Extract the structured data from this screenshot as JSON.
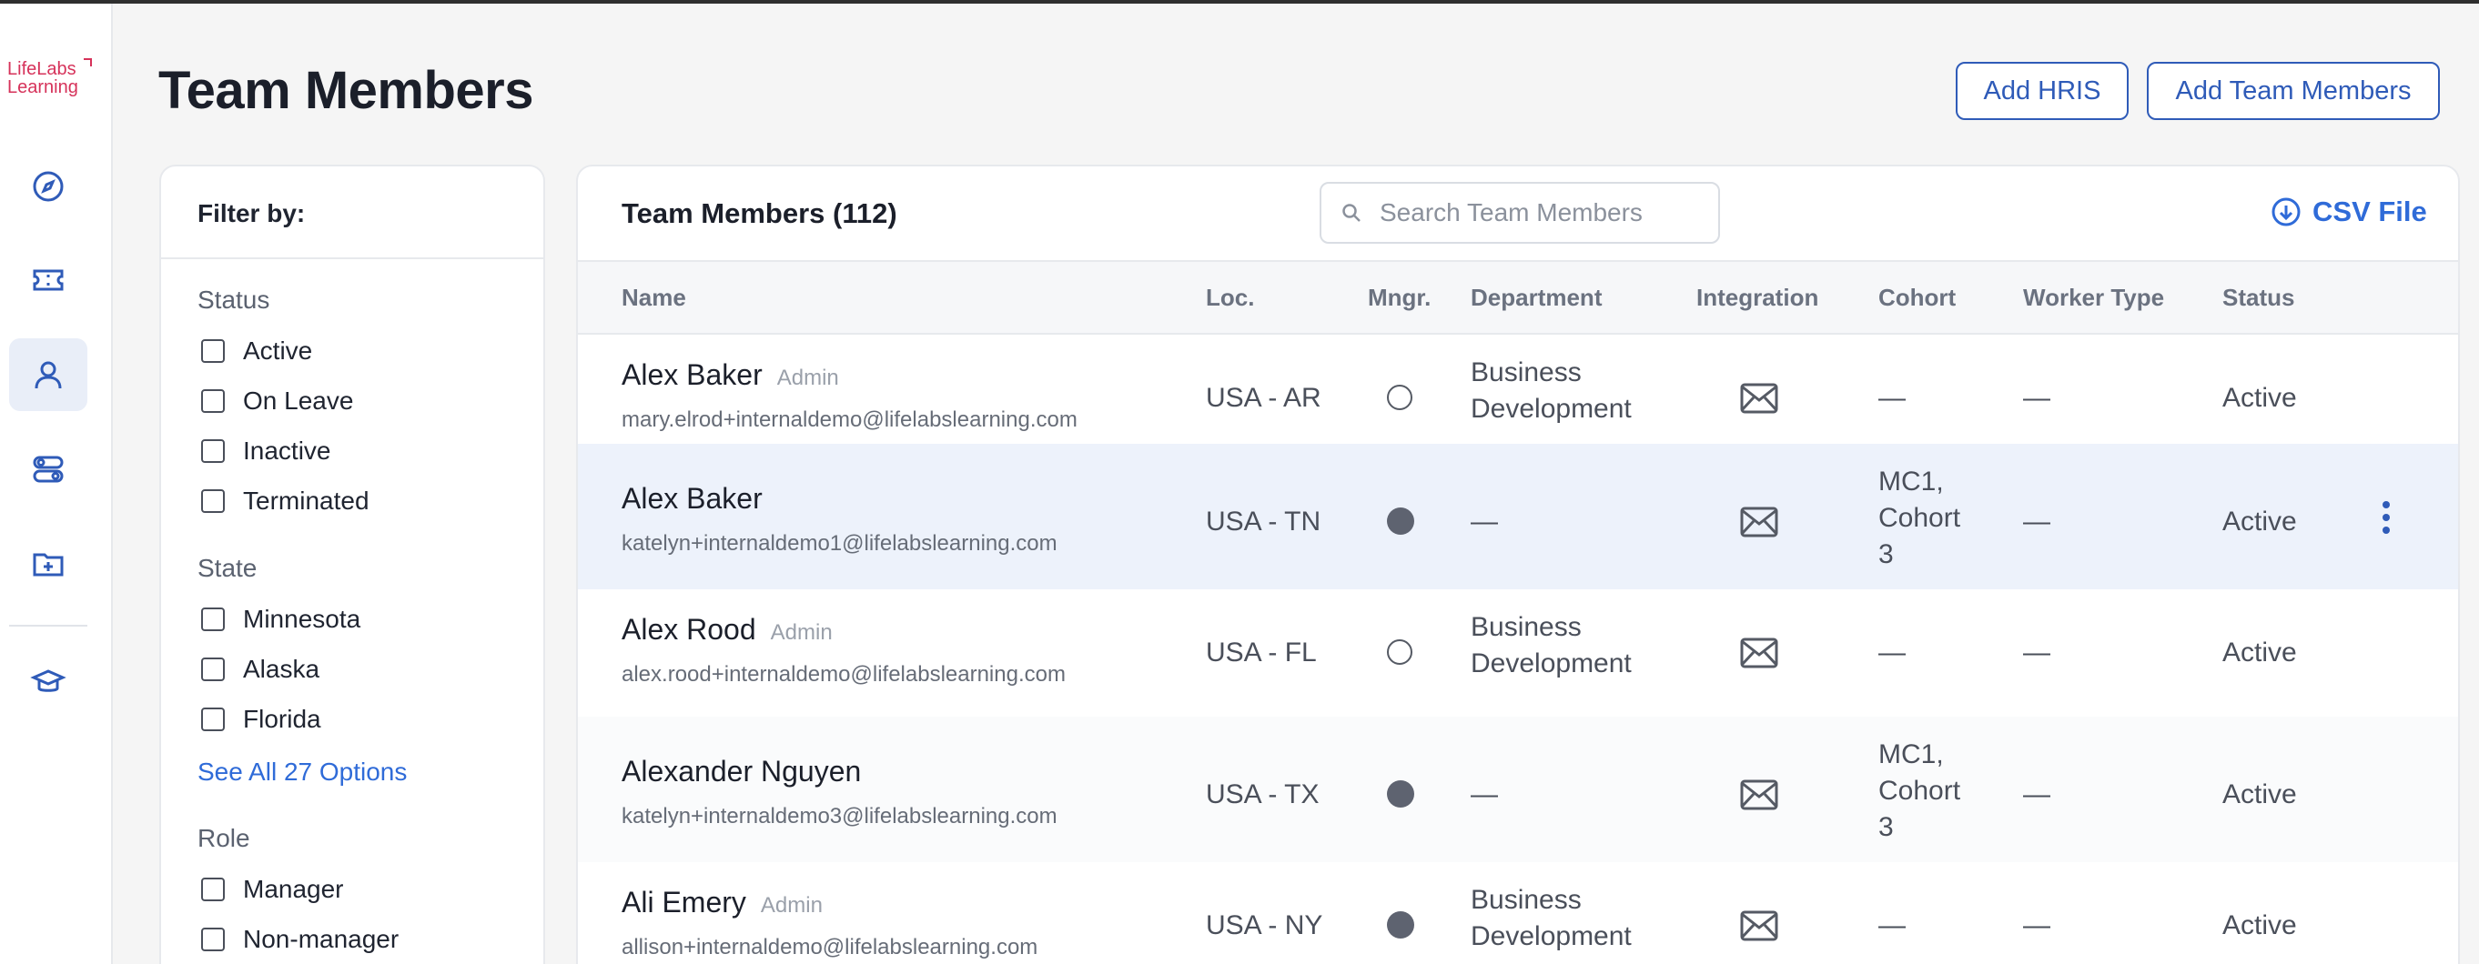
{
  "app": {
    "logo_line1": "LifeLabs",
    "logo_line2": "Learning",
    "brand_color": "#d6325a",
    "accent_color": "#2f5bb8"
  },
  "nav": {
    "items": [
      {
        "icon": "compass-icon"
      },
      {
        "icon": "ticket-icon"
      },
      {
        "icon": "user-icon",
        "active": true
      },
      {
        "icon": "toggles-icon"
      },
      {
        "icon": "folder-plus-icon"
      },
      {
        "icon": "graduation-cap-icon"
      }
    ]
  },
  "header": {
    "title": "Team Members",
    "add_hris_label": "Add HRIS",
    "add_team_members_label": "Add Team Members"
  },
  "filter": {
    "title": "Filter by:",
    "status_label": "Status",
    "status_options": [
      "Active",
      "On Leave",
      "Inactive",
      "Terminated"
    ],
    "state_label": "State",
    "state_options": [
      "Minnesota",
      "Alaska",
      "Florida"
    ],
    "state_more_link": "See All 27 Options",
    "role_label": "Role",
    "role_options": [
      "Manager",
      "Non-manager"
    ]
  },
  "table": {
    "title": "Team Members (112)",
    "search_placeholder": "Search Team Members",
    "csv_label": "CSV File",
    "columns": [
      "Name",
      "Loc.",
      "Mngr.",
      "Department",
      "Integration",
      "Cohort",
      "Worker Type",
      "Status"
    ],
    "rows": [
      {
        "name": "Alex Baker",
        "admin": "Admin",
        "email": "mary.elrod+internaldemo@lifelabslearning.com",
        "loc": "USA - AR",
        "manager": false,
        "dept1": "Business",
        "dept2": "Development",
        "cohort1": "—",
        "cohort2": "",
        "cohort3": "",
        "worker_type": "—",
        "status": "Active"
      },
      {
        "name": "Alex Baker",
        "admin": "",
        "email": "katelyn+internaldemo1@lifelabslearning.com",
        "loc": "USA - TN",
        "manager": true,
        "dept1": "—",
        "dept2": "",
        "cohort1": "MC1,",
        "cohort2": "Cohort",
        "cohort3": "3",
        "worker_type": "—",
        "status": "Active"
      },
      {
        "name": "Alex Rood",
        "admin": "Admin",
        "email": "alex.rood+internaldemo@lifelabslearning.com",
        "loc": "USA - FL",
        "manager": false,
        "dept1": "Business",
        "dept2": "Development",
        "cohort1": "—",
        "cohort2": "",
        "cohort3": "",
        "worker_type": "—",
        "status": "Active"
      },
      {
        "name": "Alexander Nguyen",
        "admin": "",
        "email": "katelyn+internaldemo3@lifelabslearning.com",
        "loc": "USA - TX",
        "manager": true,
        "dept1": "—",
        "dept2": "",
        "cohort1": "MC1,",
        "cohort2": "Cohort",
        "cohort3": "3",
        "worker_type": "—",
        "status": "Active"
      },
      {
        "name": "Ali Emery",
        "admin": "Admin",
        "email": "allison+internaldemo@lifelabslearning.com",
        "loc": "USA - NY",
        "manager": true,
        "dept1": "Business",
        "dept2": "Development",
        "cohort1": "—",
        "cohort2": "",
        "cohort3": "",
        "worker_type": "—",
        "status": "Active"
      }
    ]
  }
}
